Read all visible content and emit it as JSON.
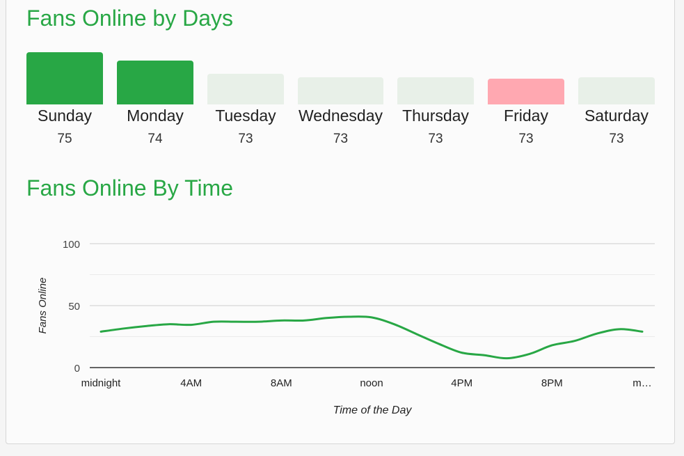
{
  "days_section": {
    "title": "Fans Online by Days",
    "days": [
      {
        "label": "Sunday",
        "value": 75,
        "status": "top"
      },
      {
        "label": "Monday",
        "value": 74,
        "status": "top"
      },
      {
        "label": "Tuesday",
        "value": 73,
        "status": "neutral"
      },
      {
        "label": "Wednesday",
        "value": 73,
        "status": "neutral"
      },
      {
        "label": "Thursday",
        "value": 73,
        "status": "neutral"
      },
      {
        "label": "Friday",
        "value": 73,
        "status": "low"
      },
      {
        "label": "Saturday",
        "value": 73,
        "status": "neutral"
      }
    ],
    "colors": {
      "top": "#28a745",
      "neutral": "#e8f0e8",
      "low": "#ffa8b1"
    }
  },
  "time_section": {
    "title": "Fans Online By Time"
  },
  "chart_data": [
    {
      "type": "bar",
      "title": "Fans Online by Days",
      "categories": [
        "Sunday",
        "Monday",
        "Tuesday",
        "Wednesday",
        "Thursday",
        "Friday",
        "Saturday"
      ],
      "values": [
        75,
        74,
        73,
        73,
        73,
        73,
        73
      ]
    },
    {
      "type": "line",
      "title": "Fans Online By Time",
      "xlabel": "Time of the Day",
      "ylabel": "Fans Online",
      "ylim": [
        0,
        100
      ],
      "yticks": [
        0,
        50,
        100
      ],
      "minor_gridlines": [
        25,
        75
      ],
      "xlim": [
        0,
        24
      ],
      "xticks": [
        {
          "hour": 0,
          "label": "midnight"
        },
        {
          "hour": 4,
          "label": "4AM"
        },
        {
          "hour": 8,
          "label": "8AM"
        },
        {
          "hour": 12,
          "label": "noon"
        },
        {
          "hour": 16,
          "label": "4PM"
        },
        {
          "hour": 20,
          "label": "8PM"
        },
        {
          "hour": 24,
          "label": "m…"
        }
      ],
      "grid": true,
      "line_color": "#28a745",
      "series": [
        {
          "name": "Fans Online",
          "x": [
            0,
            1,
            2,
            3,
            4,
            5,
            6,
            7,
            8,
            9,
            10,
            11,
            12,
            13,
            14,
            15,
            16,
            17,
            18,
            19,
            20,
            21,
            22,
            23,
            24
          ],
          "values": [
            29,
            31.5,
            33.5,
            35,
            34.5,
            37,
            37,
            37,
            38,
            38,
            40,
            41,
            40.5,
            35,
            27,
            19,
            12,
            10,
            7.5,
            11,
            18,
            21.5,
            27.5,
            31,
            29
          ]
        }
      ]
    }
  ]
}
